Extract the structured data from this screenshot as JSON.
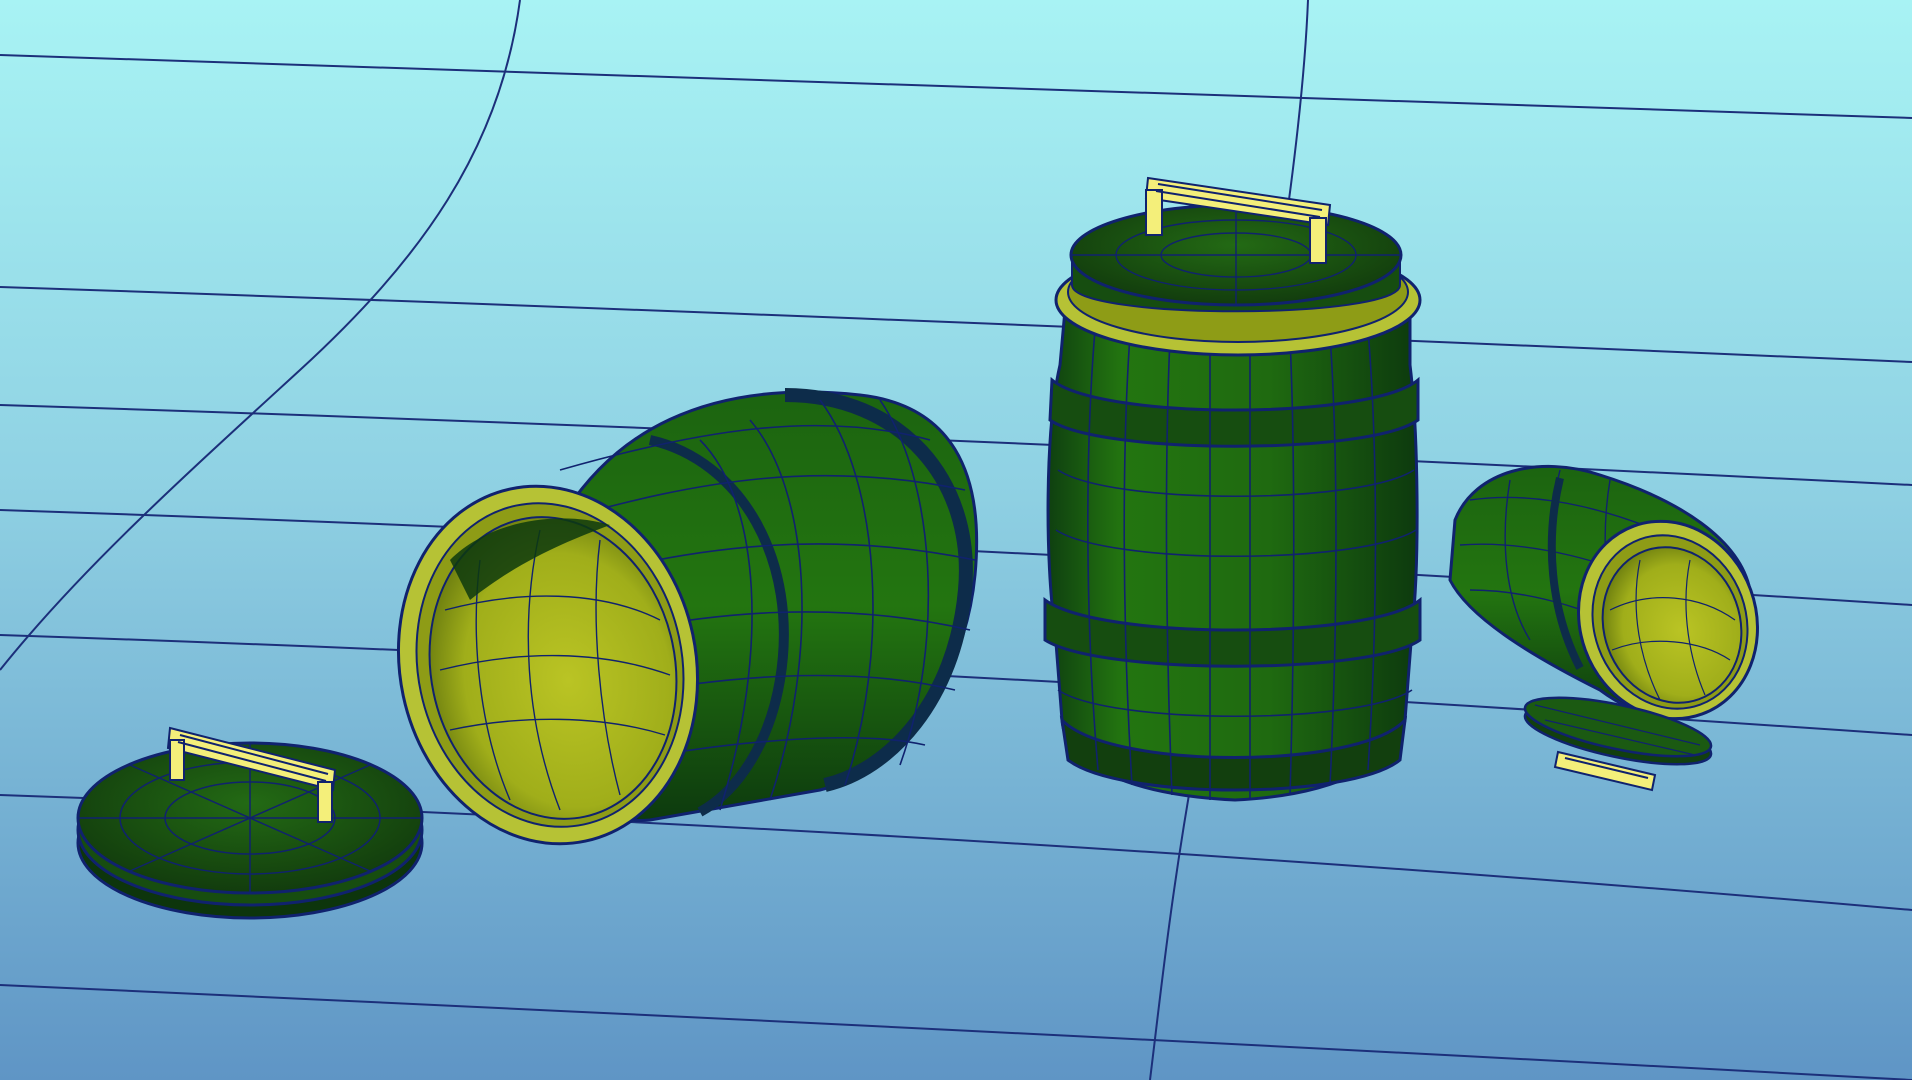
{
  "viewport": {
    "background_top": "#a8f3f4",
    "background_bottom": "#5f95c5",
    "grid_line_color": "#1c2f7a",
    "wire_color": "#10226e"
  },
  "materials": {
    "barrel_body": "#1f6a10",
    "barrel_shadow": "#0f3f10",
    "band": "#1a5a0e",
    "lid_top": "#1b5a12",
    "interior": "#a7b51d",
    "interior_shadow": "#6b7d10",
    "rim": "#b6c235",
    "handle": "#f4ef7a"
  },
  "objects": [
    {
      "name": "lid-left",
      "icon": "lid-with-handle-icon"
    },
    {
      "name": "barrel-lying",
      "icon": "barrel-icon"
    },
    {
      "name": "barrel-standing",
      "icon": "barrel-icon"
    },
    {
      "name": "barrel-small",
      "icon": "barrel-icon"
    },
    {
      "name": "lid-small",
      "icon": "lid-with-handle-icon"
    }
  ]
}
